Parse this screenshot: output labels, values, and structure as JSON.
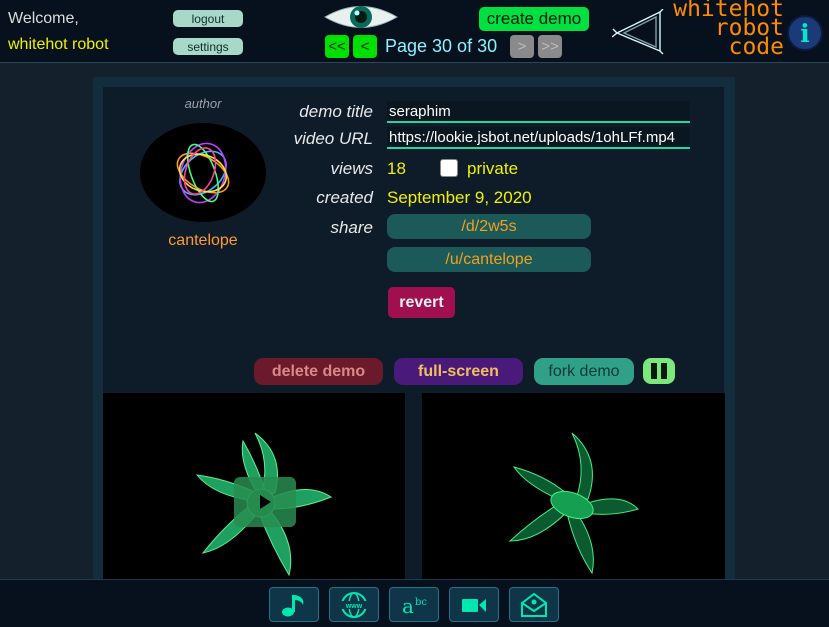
{
  "header": {
    "welcome": "Welcome,",
    "username": "whitehot robot",
    "logout_label": "logout",
    "settings_label": "settings",
    "create_label": "create demo",
    "first_label": "<<",
    "prev_label": "<",
    "next_label": ">",
    "last_label": ">>",
    "page_label": "Page 30 of 30",
    "logo_line1": "whitehot",
    "logo_line2": "robot",
    "logo_line3": "code",
    "info_label": "i"
  },
  "demo": {
    "author_label": "author",
    "author_name": "cantelope",
    "title_label": "demo title",
    "title_value": "seraphim",
    "url_label": "video URL",
    "url_value": "https://lookie.jsbot.net/uploads/1ohLFf.mp4",
    "views_label": "views",
    "views_value": "18",
    "private_label": "private",
    "private_checked": false,
    "created_label": "created",
    "created_value": "September 9, 2020",
    "share_label": "share",
    "share_link_1": "/d/2w5s",
    "share_link_2": "/u/cantelope",
    "revert_label": "revert"
  },
  "actions": {
    "delete_label": "delete demo",
    "fullscreen_label": "full-screen",
    "fork_label": "fork demo"
  },
  "toolbar": {
    "icons": [
      "music-icon",
      "www-icon",
      "text-icon",
      "video-camera-icon",
      "mail-icon"
    ]
  },
  "colors": {
    "accent_green": "#00e040",
    "logo_orange": "#ff8a00",
    "page_cyan": "#8cf0ff",
    "username_yellow": "#f0f000"
  }
}
